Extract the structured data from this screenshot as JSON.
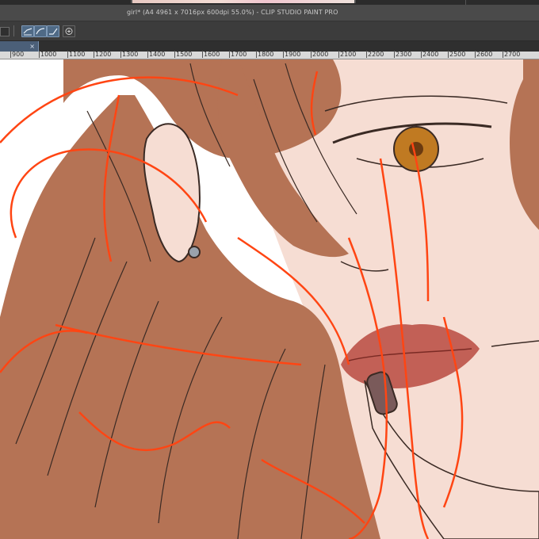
{
  "window": {
    "title": "girl* (A4 4961 x 7016px 600dpi 55.0%)  - CLIP STUDIO PAINT PRO"
  },
  "toolbar": {
    "icons": [
      "select-tool-icon",
      "curve-line-icon",
      "corner-line-icon",
      "transform-icon"
    ]
  },
  "tabbar": {
    "close_glyph": "×"
  },
  "ruler": {
    "ticks": [
      "900",
      "1000",
      "1100",
      "1200",
      "1300",
      "1400",
      "1500",
      "1600",
      "1700",
      "1800",
      "1900",
      "2000",
      "2100",
      "2200",
      "2300",
      "2400",
      "2500",
      "2600",
      "2700"
    ]
  },
  "canvas": {
    "subject": "illustration",
    "colors": {
      "hair": "#b57355",
      "skin": "#f6ddd3",
      "lips": "#b84a3f",
      "nail": "#7a5a5a",
      "eye": "#c07a22",
      "sketch_lines": "#ff4513",
      "line_art": "#3a2a24",
      "shirt": "#b3a98a"
    }
  }
}
